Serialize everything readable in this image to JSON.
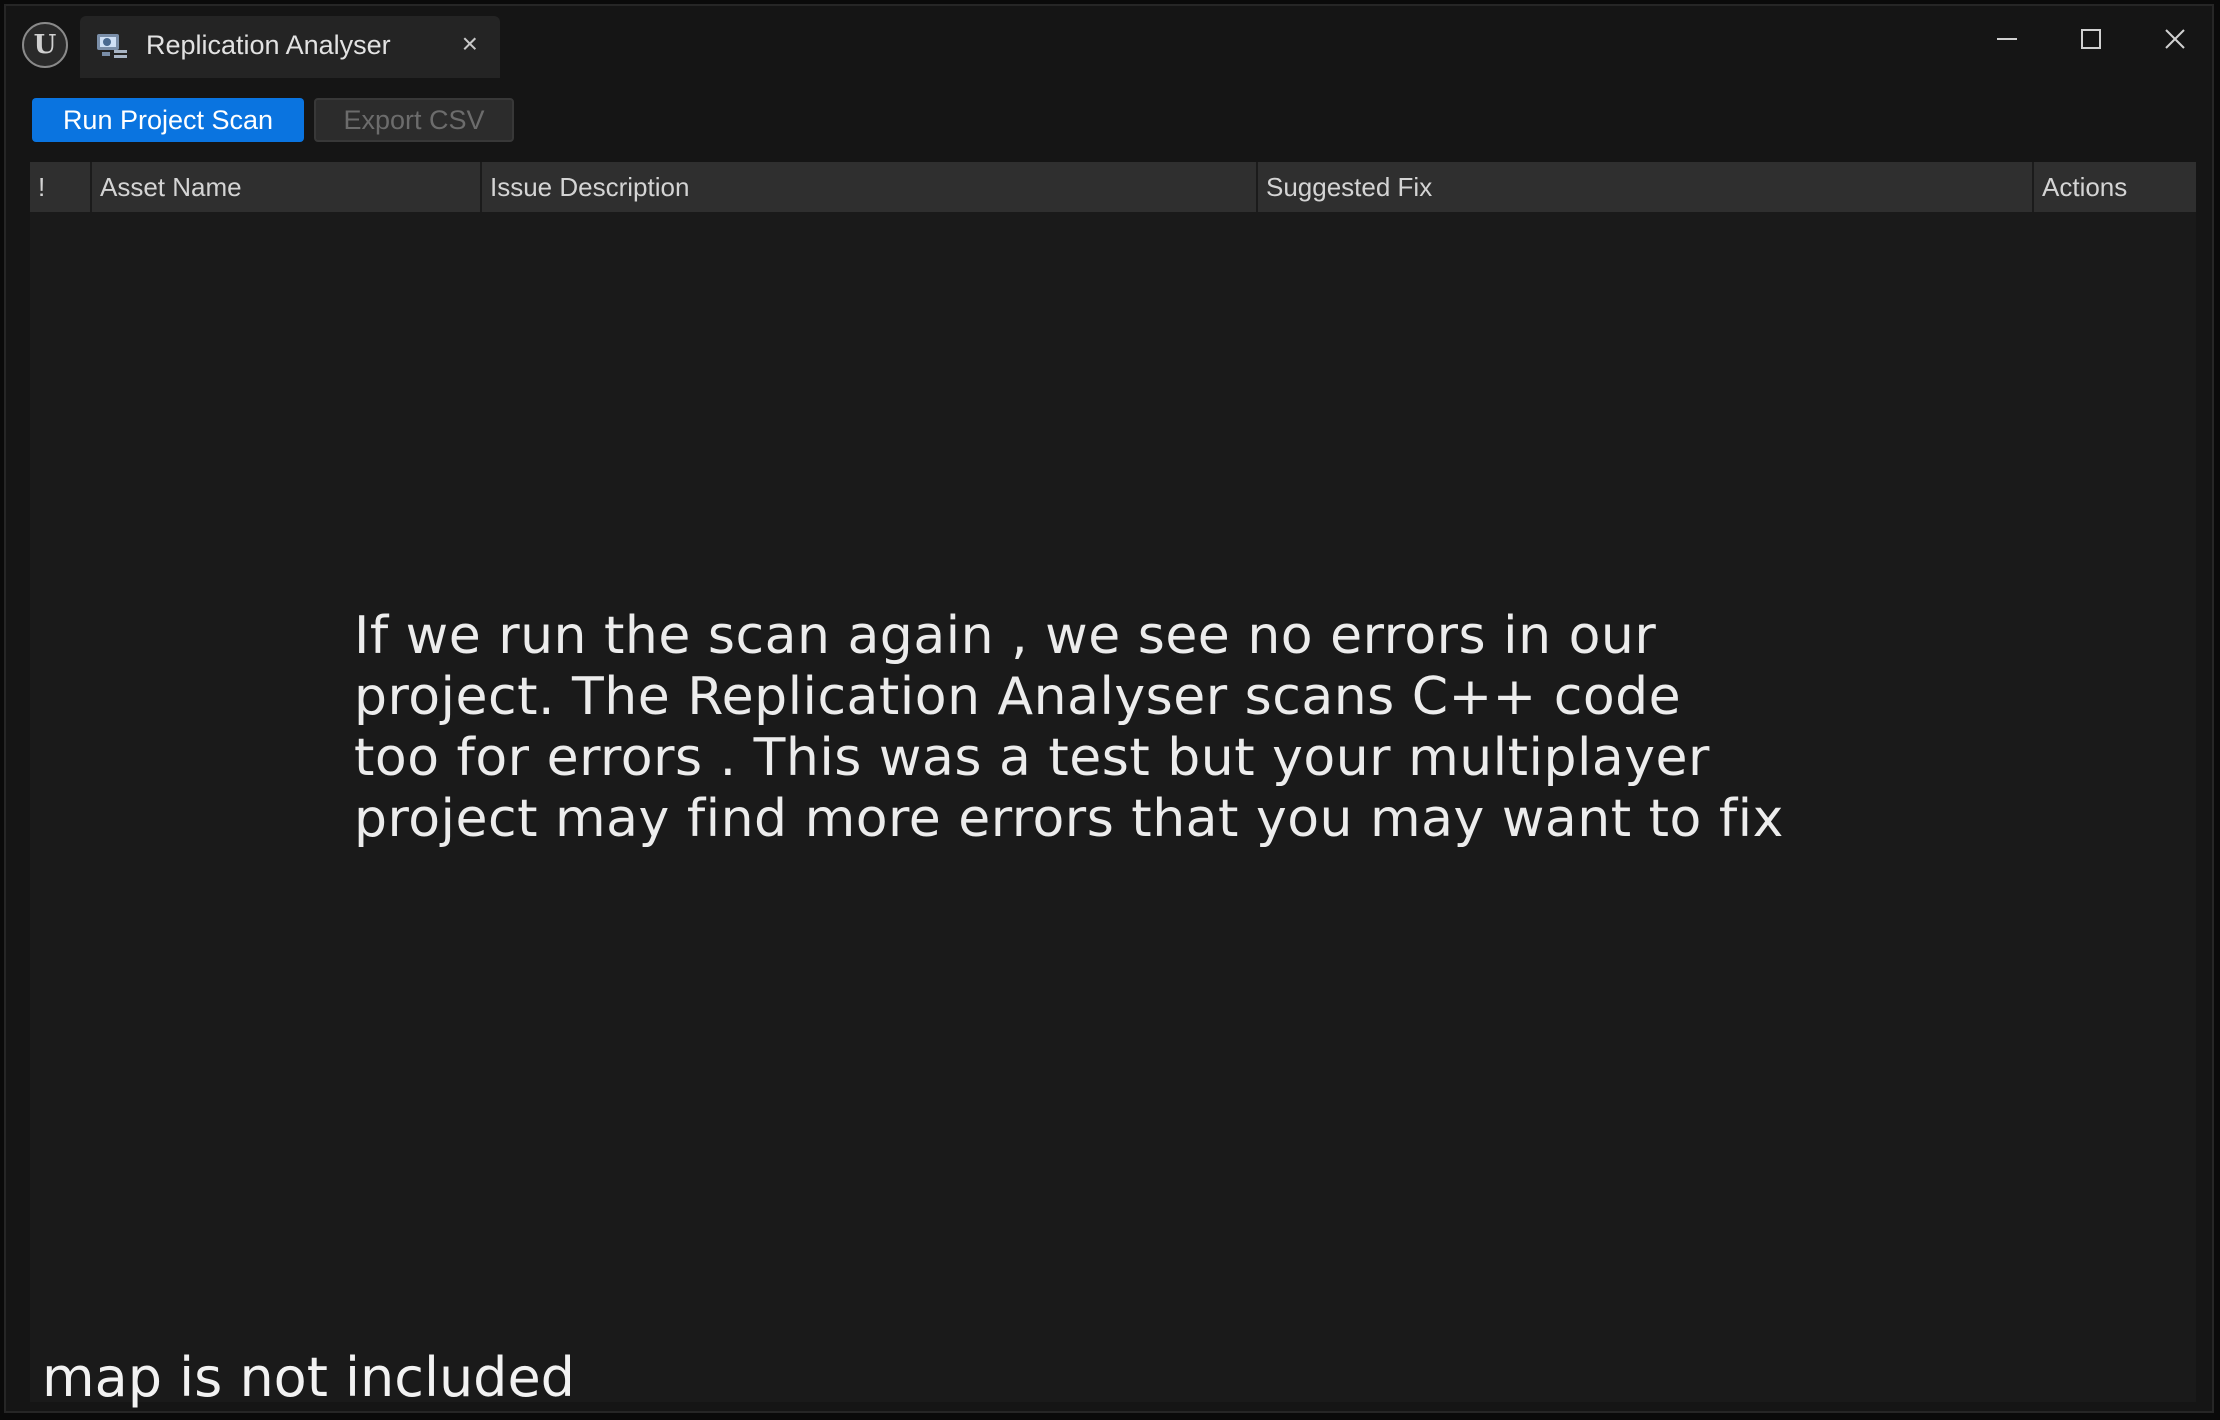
{
  "window": {
    "logo_text": "U",
    "tab_title": "Replication Analyser",
    "tab_close": "×",
    "tab_icon": "analyser-tool-icon",
    "controls": [
      "minimize-icon",
      "maximize-icon",
      "close-icon"
    ]
  },
  "toolbar": {
    "run_label": "Run Project Scan",
    "export_label": "Export CSV",
    "accent_color": "#0a74e0"
  },
  "table": {
    "columns": [
      "!",
      "Asset Name",
      "Issue Description",
      "Suggested Fix",
      "Actions"
    ],
    "rows": []
  },
  "overlay": {
    "caption_lines": [
      "If we run the scan again , we see no errors in our",
      "project. The Replication Analyser scans C++ code",
      "too for errors . This was a test but your multiplayer",
      "project may find more errors that you may want to fix"
    ],
    "footnote": "map is not included"
  }
}
